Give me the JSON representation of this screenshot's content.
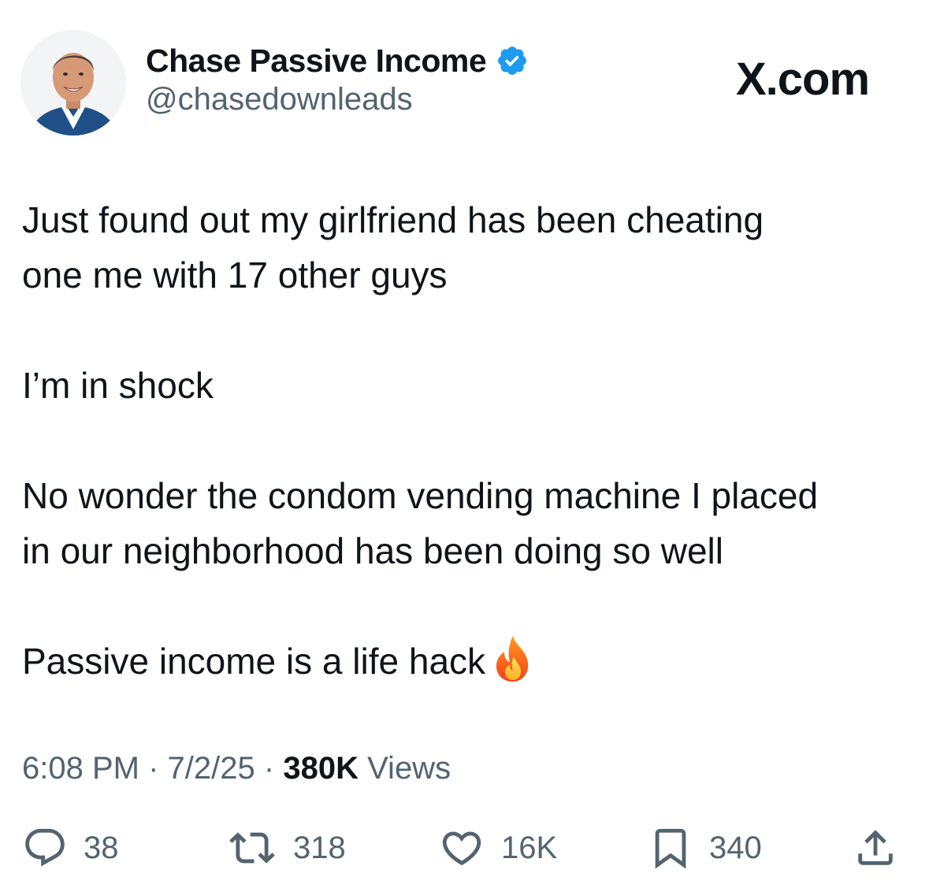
{
  "tweet": {
    "author_name": "Chase Passive Income",
    "handle": "@chasedownleads",
    "site_mark": "X.com",
    "paragraphs": {
      "p1_line1": "Just found out my girlfriend has been cheating",
      "p1_line2": "one me with 17 other guys",
      "p2": "I’m in shock",
      "p3_line1": "No wonder the condom vending machine I placed",
      "p3_line2": "in our neighborhood has been doing so well",
      "p4": "Passive income is a life hack"
    },
    "emoji_icon": "fire-icon",
    "meta": {
      "time": "6:08 PM",
      "sep": "·",
      "date": "7/2/25",
      "views_count": "380K",
      "views_label": "Views"
    },
    "actions": {
      "replies": "38",
      "reposts": "318",
      "likes": "16K",
      "bookmarks": "340"
    }
  },
  "colors": {
    "text": "#0f1419",
    "secondary": "#536471",
    "verified": "#1d9bf0"
  }
}
